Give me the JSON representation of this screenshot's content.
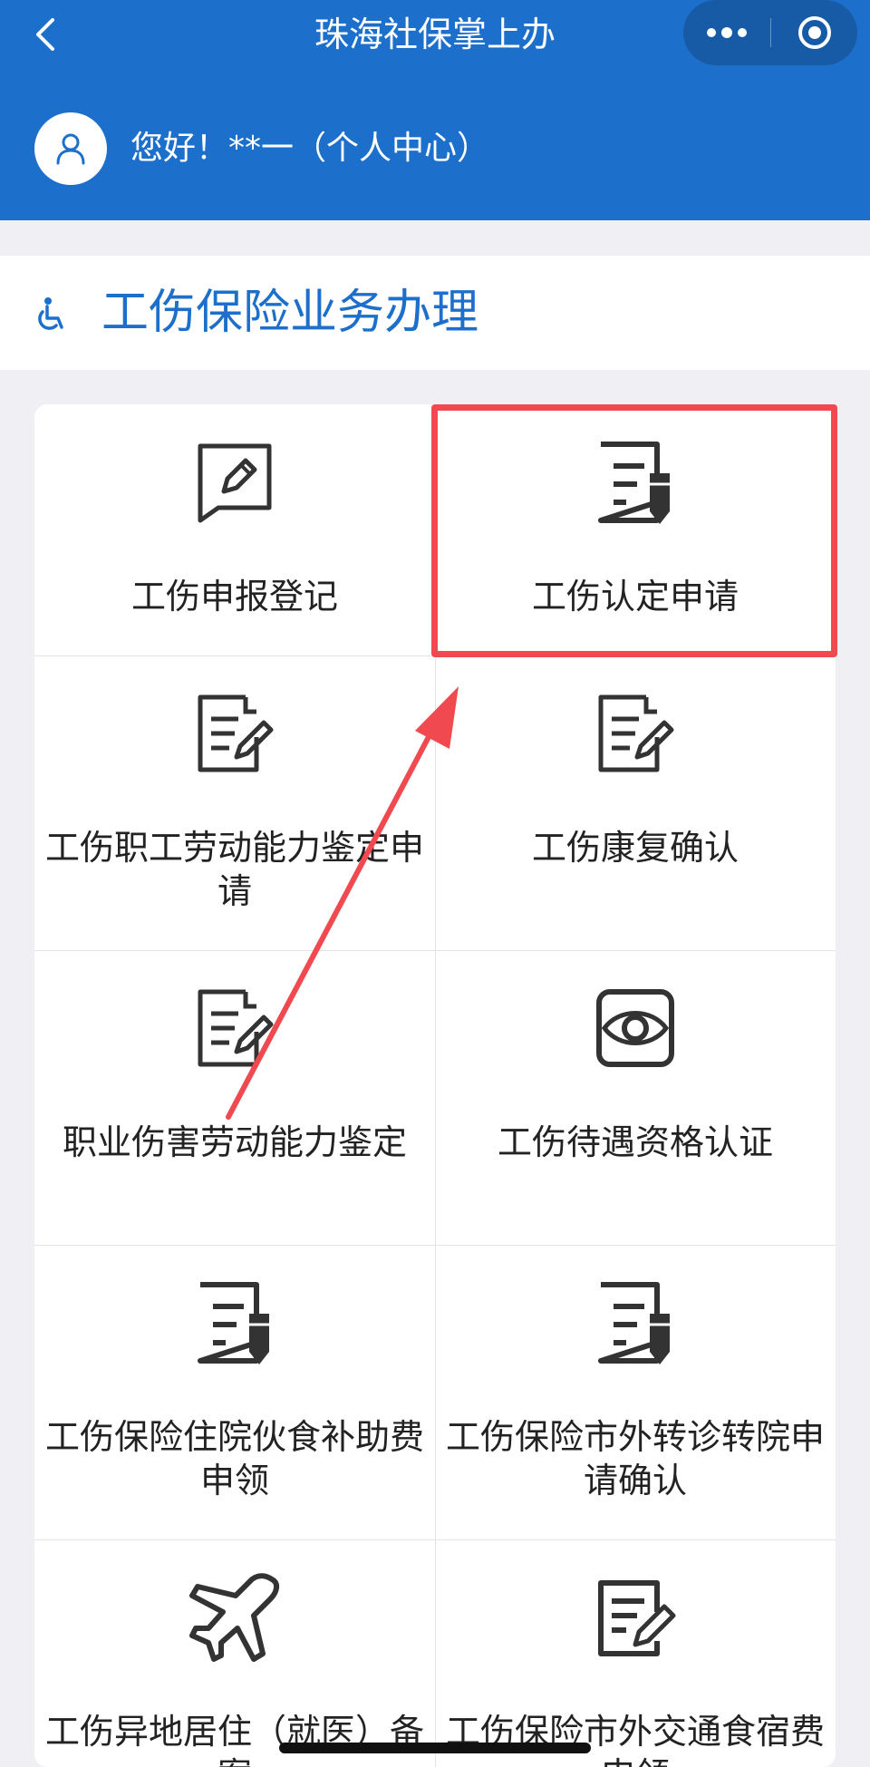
{
  "header": {
    "title": "珠海社保掌上办",
    "greeting": "您好！**一（个人中心）",
    "back_icon": "chevron-left-icon",
    "more_icon": "more-dots-icon",
    "close_icon": "target-circle-icon"
  },
  "section": {
    "title": "工伤保险业务办理",
    "icon": "wheelchair-icon"
  },
  "services": [
    {
      "label": "工伤申报登记",
      "icon": "pencil-chat-icon"
    },
    {
      "label": "工伤认定申请",
      "icon": "document-pen-icon"
    },
    {
      "label": "工伤职工劳动能力鉴定申请",
      "icon": "document-edit-icon"
    },
    {
      "label": "工伤康复确认",
      "icon": "document-edit-icon"
    },
    {
      "label": "职业伤害劳动能力鉴定",
      "icon": "document-edit-icon"
    },
    {
      "label": "工伤待遇资格认证",
      "icon": "eye-icon"
    },
    {
      "label": "工伤保险住院伙食补助费申领",
      "icon": "document-pen-icon"
    },
    {
      "label": "工伤保险市外转诊转院申请确认",
      "icon": "document-pen-icon"
    },
    {
      "label": "工伤异地居住（就医）备案",
      "icon": "airplane-icon"
    },
    {
      "label": "工伤保险市外交通食宿费申领",
      "icon": "document-sign-icon"
    }
  ],
  "annotation": {
    "highlighted_item": "工伤认定申请",
    "color": "#f04a50"
  },
  "colors": {
    "brand": "#1d6fcc",
    "background": "#efeff4"
  }
}
